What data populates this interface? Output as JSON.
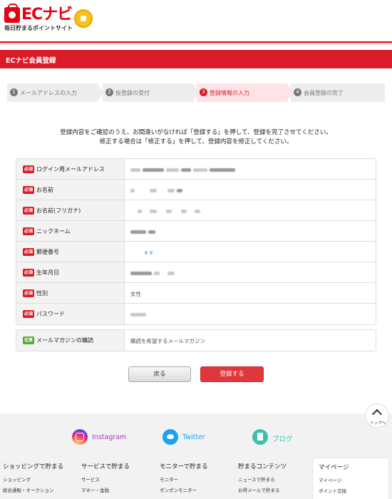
{
  "header": {
    "logo_text": "ECナビ",
    "tagline": "毎日貯まるポイントサイト"
  },
  "title": "ECナビ会員登録",
  "steps": [
    {
      "num": "1",
      "label": "メールアドレスの入力"
    },
    {
      "num": "2",
      "label": "仮登録の受付"
    },
    {
      "num": "3",
      "label": "登録情報の入力"
    },
    {
      "num": "4",
      "label": "会員登録の完了"
    }
  ],
  "intro": {
    "line1": "登録内容をご確認のうえ、お間違いがなければ「登録する」を押して、登録を完了させてください。",
    "line2": "修正する場合は「修正する」を押して、登録内容を修正してください。"
  },
  "required_badge": "必須",
  "optional_badge": "任意",
  "fields": [
    {
      "label": "ログイン用メールアドレス"
    },
    {
      "label": "お名前"
    },
    {
      "label": "お名前(フリガナ)"
    },
    {
      "label": "ニックネーム"
    },
    {
      "label": "郵便番号"
    },
    {
      "label": "生年月日"
    },
    {
      "label": "性別",
      "value": "女性"
    },
    {
      "label": "パスワード"
    }
  ],
  "newsletter": {
    "label": "メールマガジンの購読",
    "value": "購読を希望するメールマガジン"
  },
  "buttons": {
    "back": "戻る",
    "submit": "登録する"
  },
  "footer": {
    "top_button": "トップへ",
    "social": {
      "instagram": "Instagram",
      "twitter": "Twitter",
      "blog": "ブログ"
    },
    "columns": [
      {
        "heading": "ショッピングで貯まる",
        "links": [
          "ショッピング",
          "総合通販・オークション"
        ]
      },
      {
        "heading": "サービスで貯まる",
        "links": [
          "サービス",
          "マネー・金融"
        ]
      },
      {
        "heading": "モニターで貯まる",
        "links": [
          "モニター",
          "ポンポンモニター"
        ]
      },
      {
        "heading": "貯まるコンテンツ",
        "links": [
          "ニュースで貯まる",
          "お得メールで貯まる"
        ]
      },
      {
        "heading": "マイページ",
        "links": [
          "マイページ",
          "ポイント交換"
        ]
      }
    ]
  },
  "colors": {
    "brand_red": "#d81d28",
    "optional_green": "#5aa834",
    "instagram": "#a73cb7",
    "twitter": "#1da1f2",
    "blog": "#3cbfae"
  }
}
